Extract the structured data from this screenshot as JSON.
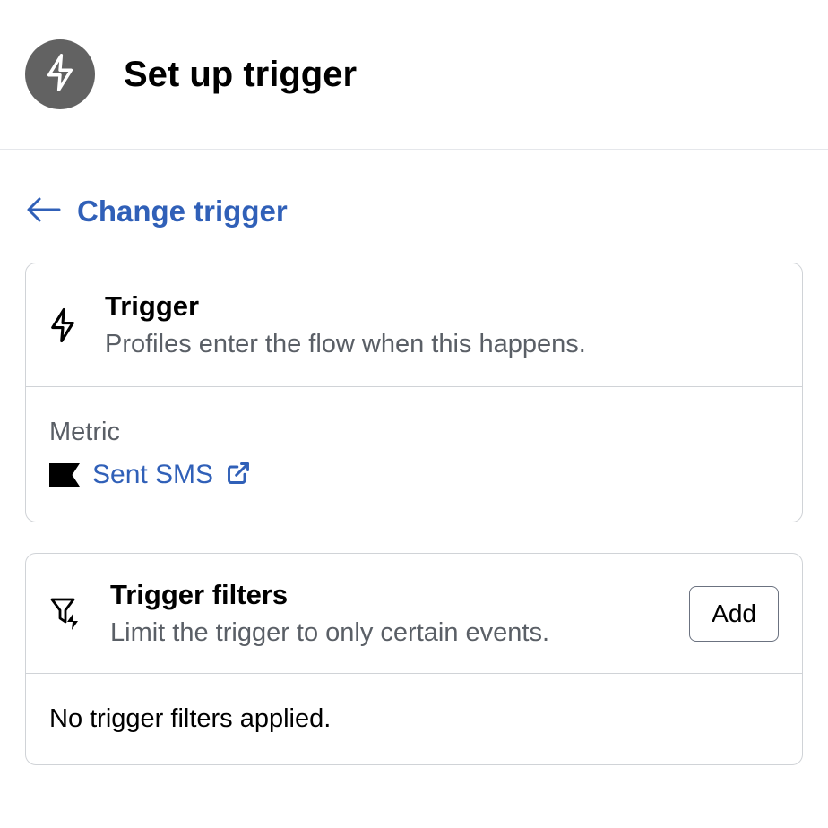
{
  "header": {
    "title": "Set up trigger"
  },
  "changeTrigger": {
    "label": "Change trigger"
  },
  "triggerCard": {
    "title": "Trigger",
    "description": "Profiles enter the flow when this happens.",
    "metricLabel": "Metric",
    "metricValue": "Sent SMS"
  },
  "filtersCard": {
    "title": "Trigger filters",
    "description": "Limit the trigger to only certain events.",
    "addButton": "Add",
    "emptyMessage": "No trigger filters applied."
  }
}
